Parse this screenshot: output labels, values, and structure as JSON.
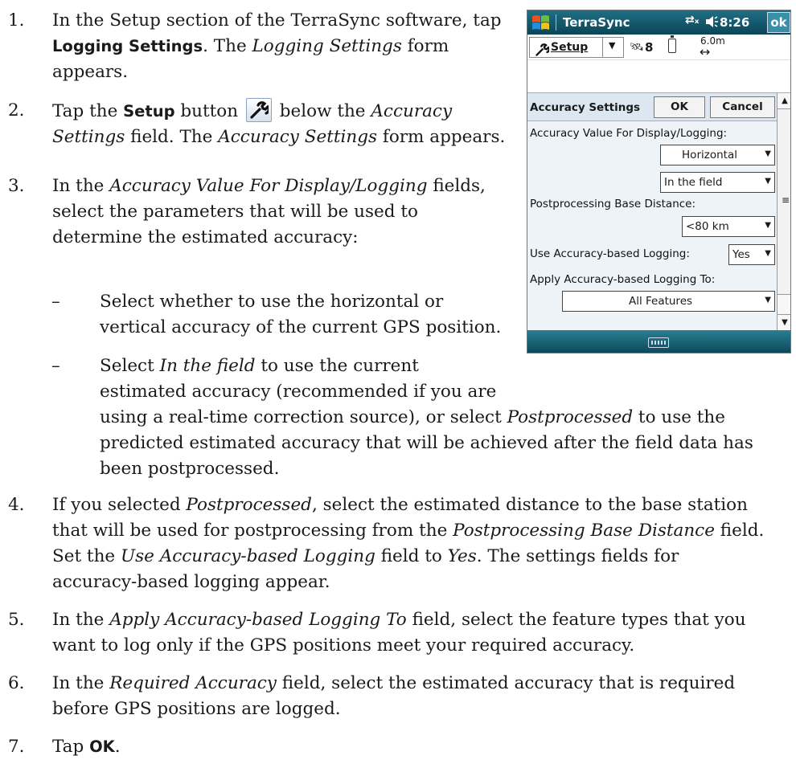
{
  "steps": [
    {
      "num": "1.",
      "lines": [
        {
          "parts": [
            "In the Setup section of the TerraSync software, tap"
          ]
        },
        {
          "parts": [
            "",
            "Logging Settings",
            ". The ",
            "Logging Settings",
            " form"
          ]
        },
        {
          "parts": [
            "appears."
          ]
        }
      ]
    },
    {
      "num": "2.",
      "lines": [
        {
          "parts": [
            "Tap the ",
            "Setup",
            " button ",
            " below the ",
            "Accuracy"
          ]
        },
        {
          "parts": [
            "Settings",
            " field. The ",
            "Accuracy Settings",
            " form appears."
          ]
        }
      ]
    },
    {
      "num": "3.",
      "lines": [
        {
          "parts": [
            "In the ",
            "Accuracy Value For Display/Logging",
            " fields,"
          ]
        },
        {
          "parts": [
            "select the parameters that will be used to"
          ]
        },
        {
          "parts": [
            "determine the estimated accuracy:"
          ]
        }
      ]
    },
    {
      "num": "4.",
      "lines": [
        {
          "parts": [
            "If you selected ",
            "Postprocessed",
            ", select the estimated distance to the base station"
          ]
        },
        {
          "parts": [
            "that will be used for postprocessing from the ",
            "Postprocessing Base Distance",
            " field."
          ]
        },
        {
          "parts": [
            "Set the ",
            "Use Accuracy-based Logging",
            " field to ",
            "Yes",
            ". The settings fields for"
          ]
        },
        {
          "parts": [
            "accuracy-based logging appear."
          ]
        }
      ]
    },
    {
      "num": "5.",
      "lines": [
        {
          "parts": [
            "In the ",
            "Apply Accuracy-based Logging To",
            " field, select the feature types that you"
          ]
        },
        {
          "parts": [
            "want to log only if the GPS positions meet your required accuracy."
          ]
        }
      ]
    },
    {
      "num": "6.",
      "lines": [
        {
          "parts": [
            "In the ",
            "Required Accuracy",
            " field, select the estimated accuracy that is required"
          ]
        },
        {
          "parts": [
            "before GPS positions are logged."
          ]
        }
      ]
    },
    {
      "num": "7.",
      "lines": [
        {
          "parts": [
            "Tap ",
            "OK",
            "."
          ]
        }
      ]
    }
  ],
  "subitems": [
    {
      "dash": "–",
      "lines": [
        {
          "parts": [
            "Select whether to use the horizontal or"
          ]
        },
        {
          "parts": [
            "vertical accuracy of the current GPS position."
          ]
        }
      ]
    },
    {
      "dash": "–",
      "lines": [
        {
          "parts": [
            "Select ",
            "In the field",
            " to use the current"
          ]
        },
        {
          "parts": [
            "estimated accuracy (recommended if you are"
          ]
        },
        {
          "parts": [
            "using a real-time correction source), or select ",
            "Postprocessed",
            " to use the"
          ]
        },
        {
          "parts": [
            "predicted estimated accuracy that will be achieved after the field data has"
          ]
        },
        {
          "parts": [
            "been postprocessed."
          ]
        }
      ]
    }
  ],
  "device": {
    "title": "TerraSync",
    "time": "8:26",
    "ok": "ok",
    "setup_label": "Setup",
    "satellites": "8",
    "precision": "6.0m",
    "precision_arrow": "↔",
    "form": {
      "title": "Accuracy Settings",
      "ok": "OK",
      "cancel": "Cancel",
      "label_accuracy_value": "Accuracy Value For Display/Logging:",
      "horizontal": "Horizontal",
      "in_field": "In the field",
      "label_base_distance": "Postprocessing Base Distance:",
      "base_distance": "<80 km",
      "label_use_logging": "Use Accuracy-based Logging:",
      "use_logging": "Yes",
      "label_apply_to": "Apply Accuracy-based Logging To:",
      "apply_to": "All Features"
    },
    "colors": {
      "titlebar": "#0b4556",
      "form_bg": "#eef3f8"
    }
  }
}
